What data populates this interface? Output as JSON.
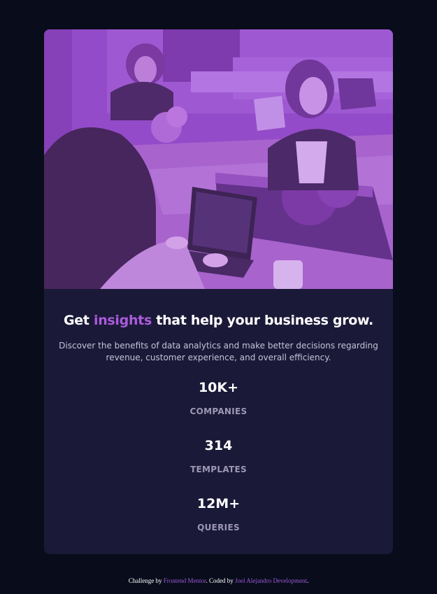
{
  "card": {
    "headline_before": "Get ",
    "headline_accent": "insights",
    "headline_after": " that help your business grow.",
    "description": "Discover the benefits of data analytics and make better decisions regarding revenue, customer experience, and overall efficiency.",
    "stats": [
      {
        "value": "10K+",
        "label": "COMPANIES"
      },
      {
        "value": "314",
        "label": "TEMPLATES"
      },
      {
        "value": "12M+",
        "label": "QUERIES"
      }
    ]
  },
  "footer": {
    "prefix": "Challenge by ",
    "link1": "Frontend Mentor",
    "middle": ". Coded by ",
    "link2": "Joel Alejandro Development",
    "suffix": "."
  },
  "colors": {
    "page_background": "#090c1b",
    "card_background": "#1b1938",
    "accent": "#aa5cdb",
    "heading": "#ffffff",
    "body_text": "#c5c3d6",
    "stat_label": "#9c98b4"
  },
  "hero_image": "people-working-at-table-photo"
}
